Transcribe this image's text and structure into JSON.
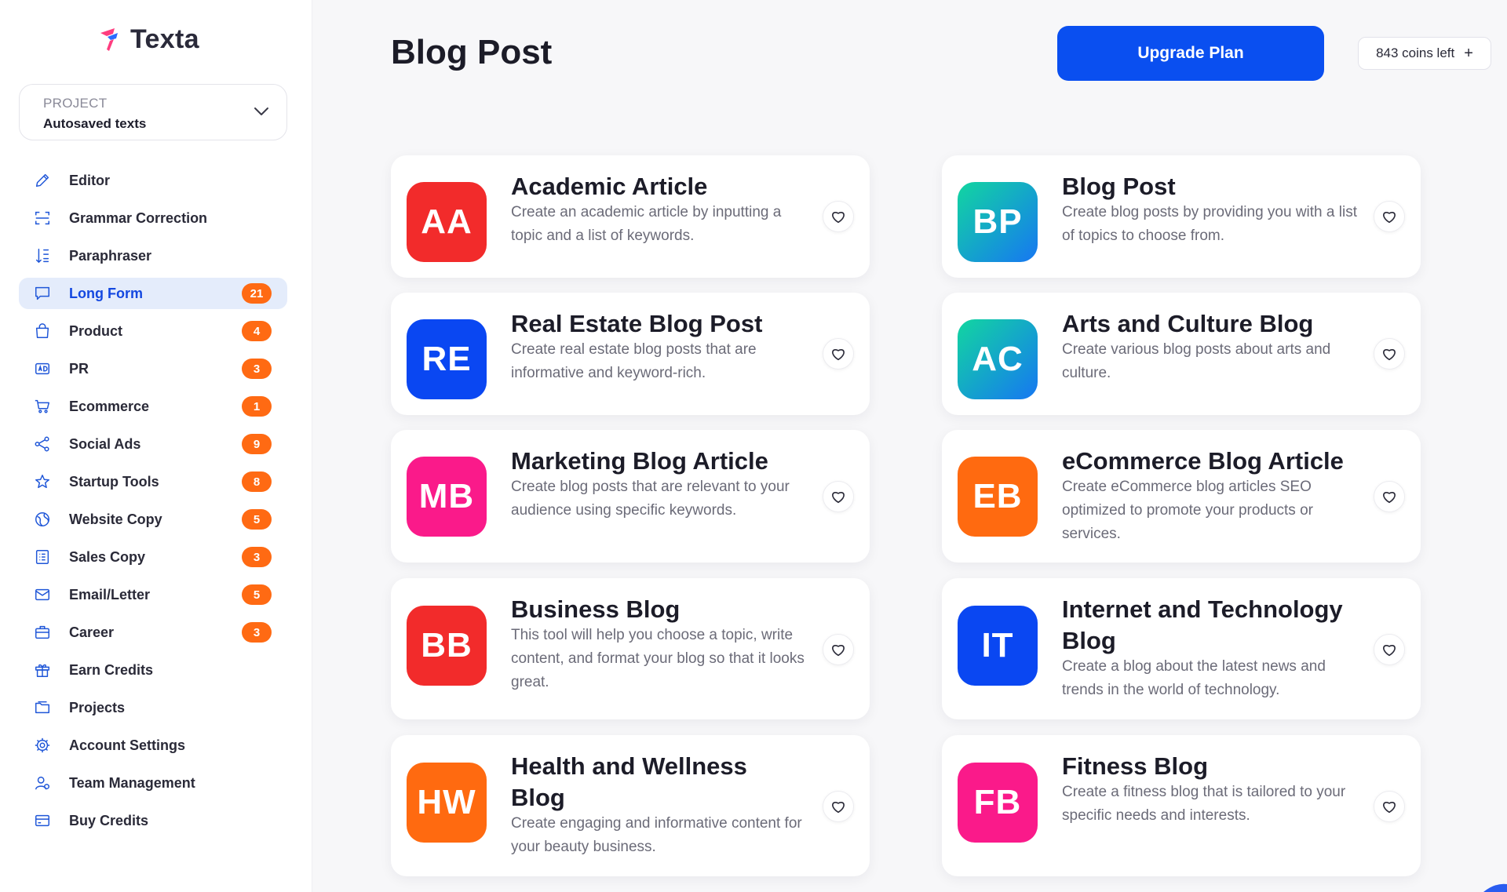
{
  "app": {
    "name": "Texta"
  },
  "project": {
    "label": "PROJECT",
    "value": "Autosaved texts"
  },
  "nav": [
    {
      "label": "Editor",
      "icon": "pencil-icon",
      "badge": ""
    },
    {
      "label": "Grammar Correction",
      "icon": "scan-icon",
      "badge": ""
    },
    {
      "label": "Paraphraser",
      "icon": "sort-icon",
      "badge": ""
    },
    {
      "label": "Long Form",
      "icon": "chat-icon",
      "badge": "21",
      "active": true
    },
    {
      "label": "Product",
      "icon": "bag-icon",
      "badge": "4"
    },
    {
      "label": "PR",
      "icon": "ad-icon",
      "badge": "3"
    },
    {
      "label": "Ecommerce",
      "icon": "cart-icon",
      "badge": "1"
    },
    {
      "label": "Social Ads",
      "icon": "share-icon",
      "badge": "9"
    },
    {
      "label": "Startup Tools",
      "icon": "star-icon",
      "badge": "8"
    },
    {
      "label": "Website Copy",
      "icon": "globe-icon",
      "badge": "5"
    },
    {
      "label": "Sales Copy",
      "icon": "list-icon",
      "badge": "3"
    },
    {
      "label": "Email/Letter",
      "icon": "mail-icon",
      "badge": "5"
    },
    {
      "label": "Career",
      "icon": "briefcase-icon",
      "badge": "3"
    },
    {
      "label": "Earn Credits",
      "icon": "gift-icon",
      "badge": ""
    },
    {
      "label": "Projects",
      "icon": "folder-icon",
      "badge": ""
    },
    {
      "label": "Account Settings",
      "icon": "gear-icon",
      "badge": ""
    },
    {
      "label": "Team Management",
      "icon": "team-icon",
      "badge": ""
    },
    {
      "label": "Buy Credits",
      "icon": "credit-card-icon",
      "badge": ""
    }
  ],
  "header": {
    "title": "Blog Post",
    "upgrade_label": "Upgrade Plan",
    "coins_label": "843 coins left",
    "coins_plus": "+"
  },
  "cards": [
    {
      "initials": "AA",
      "title": "Academic Article",
      "description": "Create an academic article by inputting a topic and a list of keywords.",
      "color": "#f22b2b"
    },
    {
      "initials": "BP",
      "title": "Blog Post",
      "description": "Create blog posts by providing you with a list of topics to choose from.",
      "color_from": "#12d6a0",
      "color_to": "#1677f2"
    },
    {
      "initials": "RE",
      "title": "Real Estate Blog Post",
      "description": "Create real estate blog posts that are informative and keyword-rich.",
      "color": "#0a47f2"
    },
    {
      "initials": "AC",
      "title": "Arts and Culture Blog",
      "description": "Create various blog posts about arts and culture.",
      "color_from": "#12d6a0",
      "color_to": "#1677f2"
    },
    {
      "initials": "MB",
      "title": "Marketing Blog Article",
      "description": "Create blog posts that are relevant to your audience using specific keywords.",
      "color": "#fa1a8a"
    },
    {
      "initials": "EB",
      "title": "eCommerce Blog Article",
      "description": "Create eCommerce blog articles SEO optimized to promote your products or services.",
      "color": "#ff6a10"
    },
    {
      "initials": "BB",
      "title": "Business Blog",
      "description": "This tool will help you choose a topic, write content, and format your blog so that it looks great.",
      "color": "#f22b2b"
    },
    {
      "initials": "IT",
      "title": "Internet and Technology Blog",
      "description": "Create a blog about the latest news and trends in the world of technology.",
      "color": "#0a47f2"
    },
    {
      "initials": "HW",
      "title": "Health and Wellness Blog",
      "description": "Create engaging and informative content for your beauty business.",
      "color": "#ff6a10"
    },
    {
      "initials": "FB",
      "title": "Fitness Blog",
      "description": "Create a fitness blog that is tailored to your specific needs and interests.",
      "color": "#fa1a8a"
    }
  ],
  "theme": {
    "accent": "#0a4ff0",
    "badge": "#ff6a13",
    "active_bg": "#e4ecfb"
  }
}
